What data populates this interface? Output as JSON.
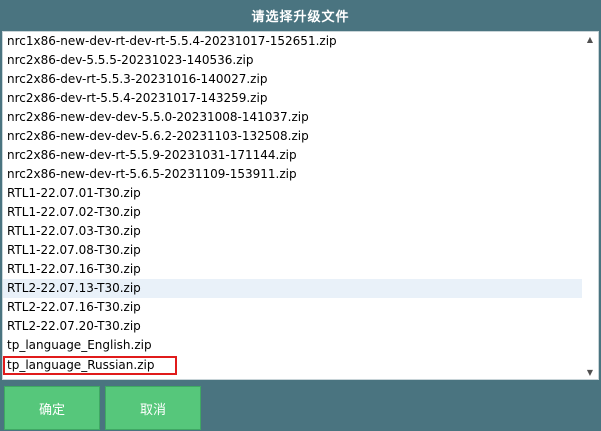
{
  "dialog": {
    "title": "请选择升级文件"
  },
  "files": [
    "nrc1x86-new-dev-rt-dev-rt-5.5.4-20231017-152651.zip",
    "nrc2x86-dev-5.5.5-20231023-140536.zip",
    "nrc2x86-dev-rt-5.5.3-20231016-140027.zip",
    "nrc2x86-dev-rt-5.5.4-20231017-143259.zip",
    "nrc2x86-new-dev-dev-5.5.0-20231008-141037.zip",
    "nrc2x86-new-dev-dev-5.6.2-20231103-132508.zip",
    "nrc2x86-new-dev-rt-5.5.9-20231031-171144.zip",
    "nrc2x86-new-dev-rt-5.6.5-20231109-153911.zip",
    "RTL1-22.07.01-T30.zip",
    "RTL1-22.07.02-T30.zip",
    "RTL1-22.07.03-T30.zip",
    "RTL1-22.07.08-T30.zip",
    "RTL1-22.07.16-T30.zip",
    "RTL2-22.07.13-T30.zip",
    "RTL2-22.07.16-T30.zip",
    "RTL2-22.07.20-T30.zip",
    "tp_language_English.zip",
    "tp_language_Russian.zip"
  ],
  "buttons": {
    "ok_label": "确定",
    "cancel_label": "取消"
  },
  "scrollbar": {
    "up_icon": "▲",
    "down_icon": "▼"
  }
}
